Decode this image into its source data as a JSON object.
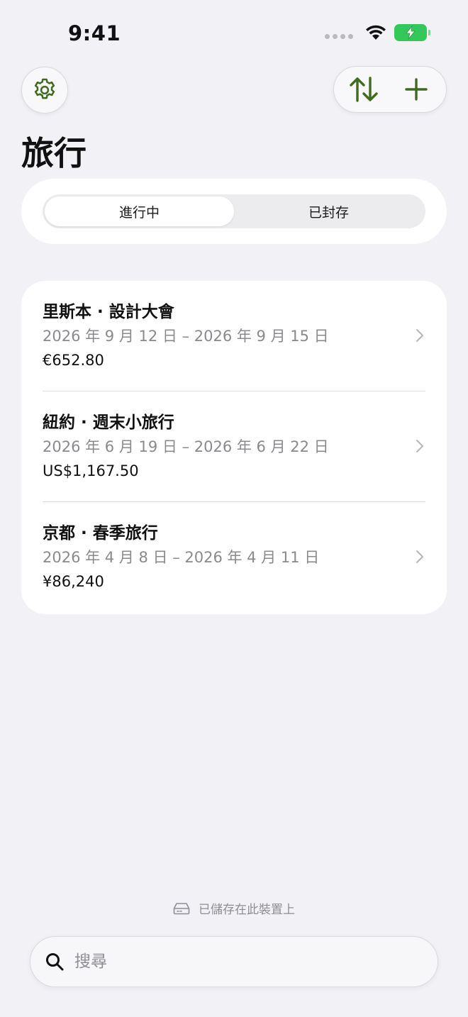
{
  "status_bar": {
    "time": "9:41"
  },
  "header": {
    "title": "旅行"
  },
  "segments": {
    "active": "進行中",
    "archived": "已封存"
  },
  "trips": [
    {
      "name": "里斯本 · 設計大會",
      "dates": "2026 年 9 月 12 日 – 2026 年 9 月 15 日",
      "total": "€652.80"
    },
    {
      "name": "紐約 · 週末小旅行",
      "dates": "2026 年 6 月 19 日 – 2026 年 6 月 22 日",
      "total": "US$1,167.50"
    },
    {
      "name": "京都 · 春季旅行",
      "dates": "2026 年 4 月 8 日 – 2026 年 4 月 11 日",
      "total": "¥86,240"
    }
  ],
  "footer": {
    "storage_note": "已儲存在此裝置上"
  },
  "search": {
    "placeholder": "搜尋"
  },
  "icons": {
    "settings": "gear-icon",
    "sort": "sort-arrows-icon",
    "add": "plus-icon",
    "storage": "drive-icon",
    "search": "magnifier-icon"
  },
  "colors": {
    "accent": "#3f6b1f",
    "background": "#f1f1f6",
    "card": "#ffffff",
    "secondary_text": "#8a8a8e",
    "battery": "#34c759"
  }
}
